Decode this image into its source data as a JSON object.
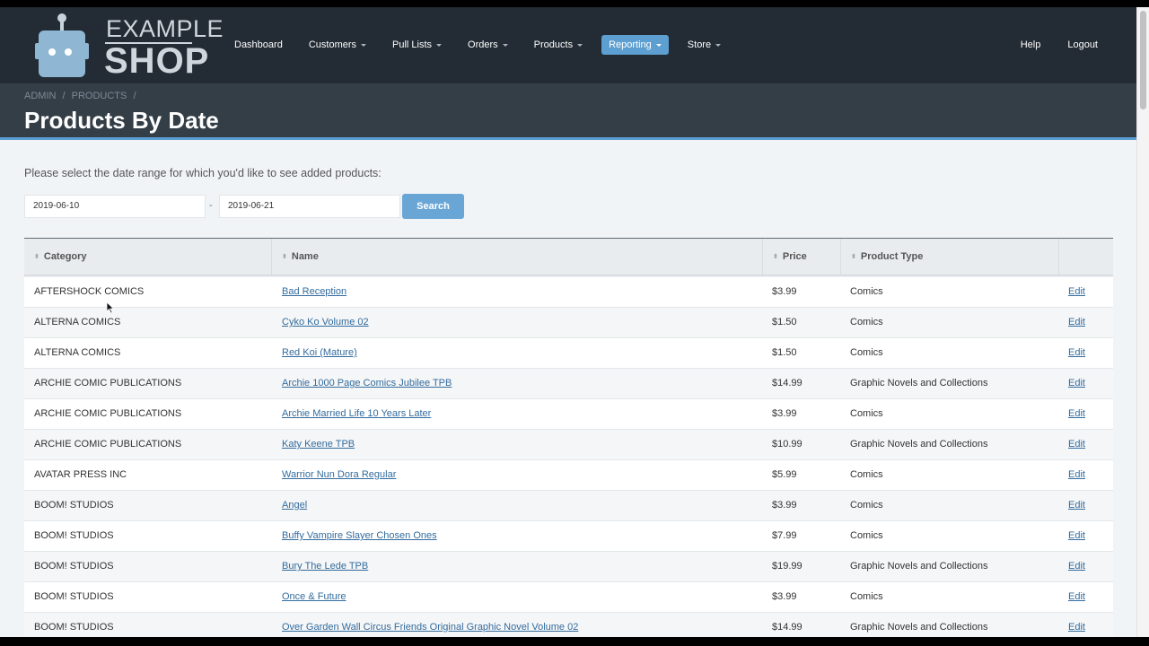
{
  "brand": {
    "line1": "EXAMPLE",
    "line2": "SHOP"
  },
  "nav": {
    "items": [
      {
        "label": "Dashboard",
        "dropdown": false,
        "active": false
      },
      {
        "label": "Customers",
        "dropdown": true,
        "active": false
      },
      {
        "label": "Pull Lists",
        "dropdown": true,
        "active": false
      },
      {
        "label": "Orders",
        "dropdown": true,
        "active": false
      },
      {
        "label": "Products",
        "dropdown": true,
        "active": false
      },
      {
        "label": "Reporting",
        "dropdown": true,
        "active": true
      },
      {
        "label": "Store",
        "dropdown": true,
        "active": false
      }
    ],
    "right": [
      {
        "label": "Help"
      },
      {
        "label": "Logout"
      }
    ]
  },
  "breadcrumb": [
    "ADMIN",
    "/",
    "PRODUCTS",
    "/"
  ],
  "page_title": "Products By Date",
  "filter": {
    "prompt": "Please select the date range for which you'd like to see added products:",
    "start_date": "2019-06-10",
    "separator": "-",
    "end_date": "2019-06-21",
    "search_label": "Search"
  },
  "table": {
    "columns": [
      "Category",
      "Name",
      "Price",
      "Product Type",
      ""
    ],
    "rows": [
      {
        "category": "AFTERSHOCK COMICS",
        "name": "Bad Reception",
        "price": "$3.99",
        "type": "Comics",
        "action": "Edit"
      },
      {
        "category": "ALTERNA COMICS",
        "name": "Cyko Ko Volume 02",
        "price": "$1.50",
        "type": "Comics",
        "action": "Edit"
      },
      {
        "category": "ALTERNA COMICS",
        "name": "Red Koi (Mature)",
        "price": "$1.50",
        "type": "Comics",
        "action": "Edit"
      },
      {
        "category": "ARCHIE COMIC PUBLICATIONS",
        "name": "Archie 1000 Page Comics Jubilee TPB",
        "price": "$14.99",
        "type": "Graphic Novels and Collections",
        "action": "Edit"
      },
      {
        "category": "ARCHIE COMIC PUBLICATIONS",
        "name": "Archie Married Life 10 Years Later",
        "price": "$3.99",
        "type": "Comics",
        "action": "Edit"
      },
      {
        "category": "ARCHIE COMIC PUBLICATIONS",
        "name": "Katy Keene TPB",
        "price": "$10.99",
        "type": "Graphic Novels and Collections",
        "action": "Edit"
      },
      {
        "category": "AVATAR PRESS INC",
        "name": "Warrior Nun Dora Regular",
        "price": "$5.99",
        "type": "Comics",
        "action": "Edit"
      },
      {
        "category": "BOOM! STUDIOS",
        "name": "Angel",
        "price": "$3.99",
        "type": "Comics",
        "action": "Edit"
      },
      {
        "category": "BOOM! STUDIOS",
        "name": "Buffy Vampire Slayer Chosen Ones",
        "price": "$7.99",
        "type": "Comics",
        "action": "Edit"
      },
      {
        "category": "BOOM! STUDIOS",
        "name": "Bury The Lede TPB",
        "price": "$19.99",
        "type": "Graphic Novels and Collections",
        "action": "Edit"
      },
      {
        "category": "BOOM! STUDIOS",
        "name": "Once & Future",
        "price": "$3.99",
        "type": "Comics",
        "action": "Edit"
      },
      {
        "category": "BOOM! STUDIOS",
        "name": "Over Garden Wall Circus Friends Original Graphic Novel Volume 02",
        "price": "$14.99",
        "type": "Graphic Novels and Collections",
        "action": "Edit"
      }
    ]
  },
  "colors": {
    "header_bg": "#232b34",
    "accent": "#5d9fd0",
    "link": "#336c9e"
  }
}
